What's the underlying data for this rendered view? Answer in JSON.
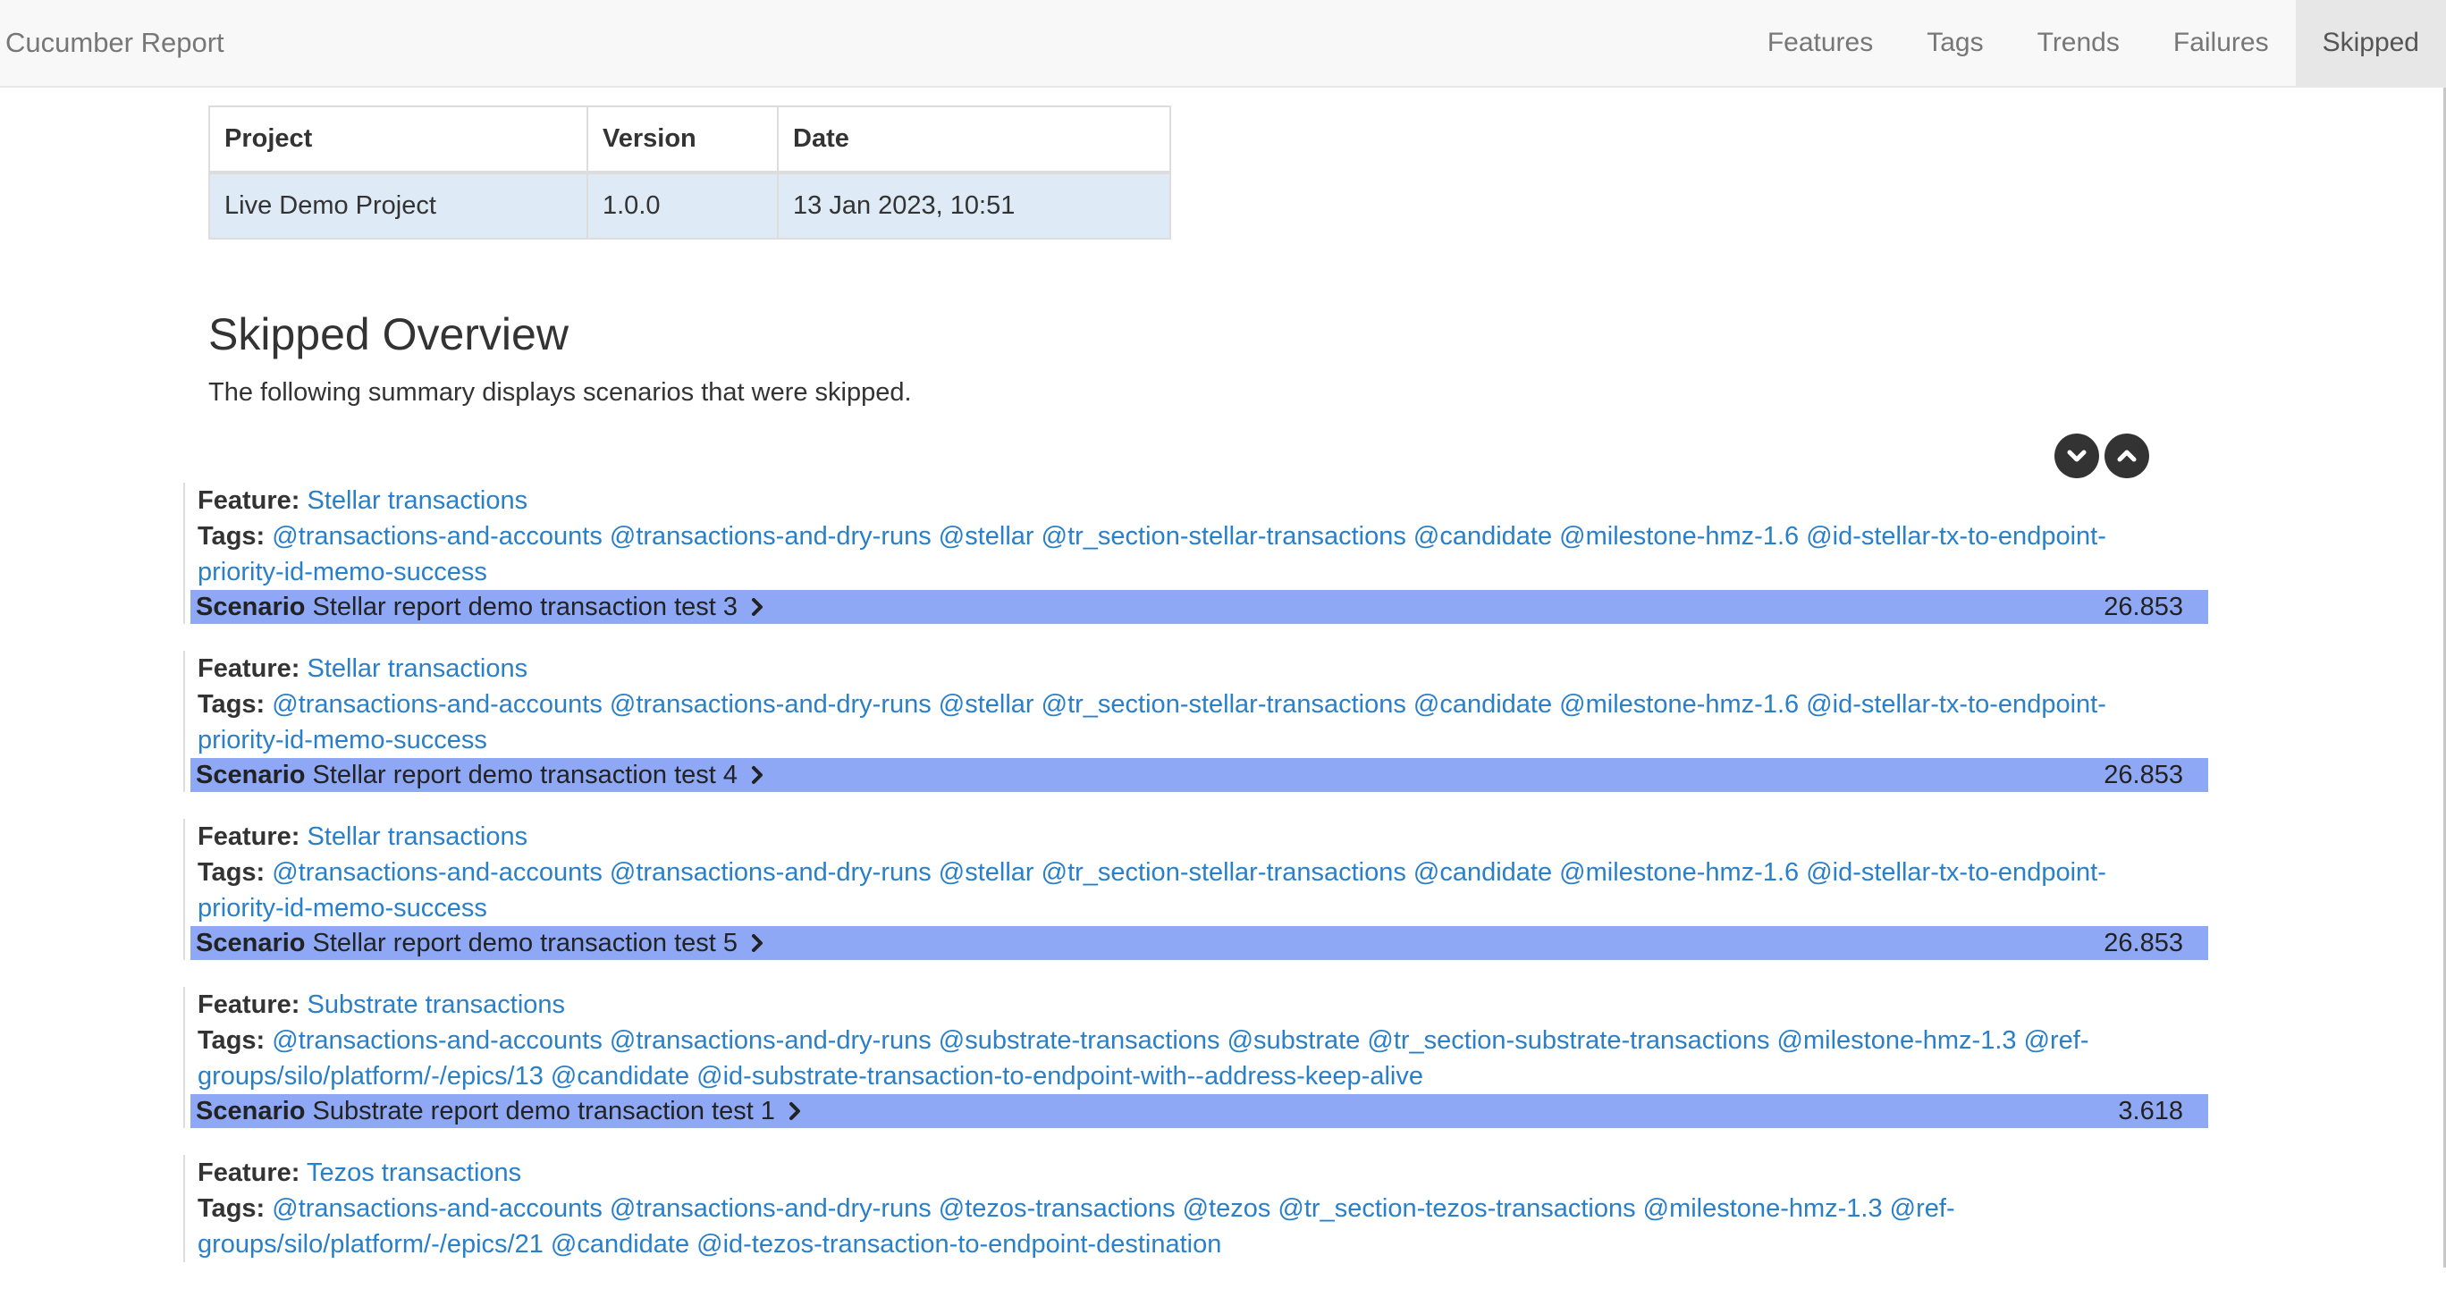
{
  "navbar": {
    "brand": "Cucumber Report",
    "items": [
      {
        "label": "Features",
        "active": false
      },
      {
        "label": "Tags",
        "active": false
      },
      {
        "label": "Trends",
        "active": false
      },
      {
        "label": "Failures",
        "active": false
      },
      {
        "label": "Skipped",
        "active": true
      }
    ]
  },
  "info": {
    "headers": {
      "project": "Project",
      "version": "Version",
      "date": "Date"
    },
    "row": {
      "project": "Live Demo Project",
      "version": "1.0.0",
      "date": "13 Jan 2023, 10:51"
    }
  },
  "title": "Skipped Overview",
  "subtitle": "The following summary displays scenarios that were skipped.",
  "labels": {
    "feature": "Feature:",
    "tags": "Tags:",
    "scenario": "Scenario"
  },
  "icons": {
    "expand": "chevron-down-circle-icon",
    "collapse": "chevron-up-circle-icon",
    "scenario": "chevron-right-icon"
  },
  "colors": {
    "scenario_bar": "#8fa8f6",
    "link": "#2a7fc9",
    "navbar": "#f8f8f8"
  },
  "entries": [
    {
      "feature": "Stellar transactions",
      "tags": "@transactions-and-accounts @transactions-and-dry-runs @stellar @tr_section-stellar-transactions @candidate @milestone-hmz-1.6 @id-stellar-tx-to-endpoint-priority-id-memo-success",
      "scenario": "Stellar report demo transaction test 3",
      "duration": "26.853"
    },
    {
      "feature": "Stellar transactions",
      "tags": "@transactions-and-accounts @transactions-and-dry-runs @stellar @tr_section-stellar-transactions @candidate @milestone-hmz-1.6 @id-stellar-tx-to-endpoint-priority-id-memo-success",
      "scenario": "Stellar report demo transaction test 4",
      "duration": "26.853"
    },
    {
      "feature": "Stellar transactions",
      "tags": "@transactions-and-accounts @transactions-and-dry-runs @stellar @tr_section-stellar-transactions @candidate @milestone-hmz-1.6 @id-stellar-tx-to-endpoint-priority-id-memo-success",
      "scenario": "Stellar report demo transaction test 5",
      "duration": "26.853"
    },
    {
      "feature": "Substrate transactions",
      "tags": "@transactions-and-accounts @transactions-and-dry-runs @substrate-transactions @substrate @tr_section-substrate-transactions @milestone-hmz-1.3 @ref-groups/silo/platform/-/epics/13 @candidate @id-substrate-transaction-to-endpoint-with--address-keep-alive",
      "scenario": "Substrate report demo transaction test 1",
      "duration": "3.618"
    },
    {
      "feature": "Tezos transactions",
      "tags": "@transactions-and-accounts @transactions-and-dry-runs @tezos-transactions @tezos @tr_section-tezos-transactions @milestone-hmz-1.3 @ref-groups/silo/platform/-/epics/21 @candidate @id-tezos-transaction-to-endpoint-destination",
      "scenario": "",
      "duration": ""
    }
  ]
}
